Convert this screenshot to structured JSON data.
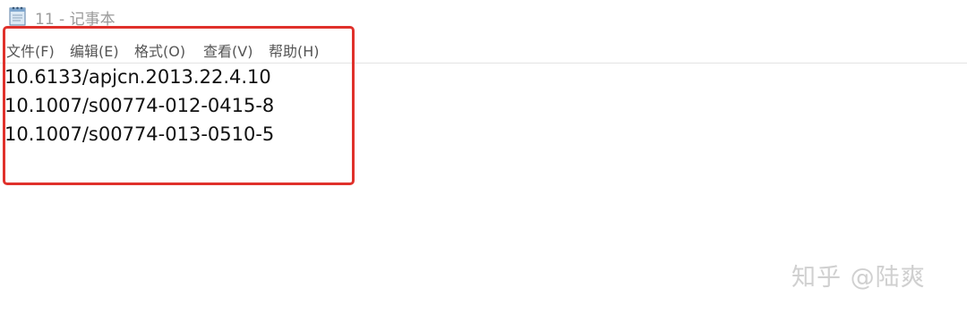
{
  "window": {
    "title": "11 - 记事本",
    "app_icon": "notepad-icon"
  },
  "menu": {
    "items": [
      "文件(F)",
      "编辑(E)",
      "格式(O)",
      "查看(V)",
      "帮助(H)"
    ]
  },
  "editor": {
    "lines": [
      "10.6133/apjcn.2013.22.4.10",
      "10.1007/s00774-012-0415-8",
      "10.1007/s00774-013-0510-5"
    ]
  },
  "annotation": {
    "highlight_color": "#e0312b"
  },
  "watermark": {
    "text": "知乎 @陆爽"
  }
}
